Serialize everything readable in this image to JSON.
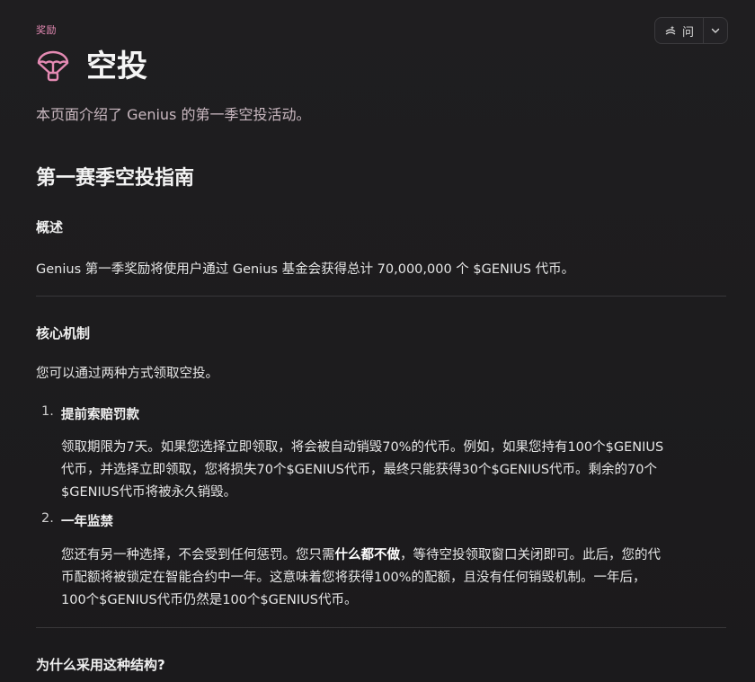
{
  "header": {
    "section_label": "奖励",
    "ask_button_label": "问",
    "title": "空投",
    "subtitle": "本页面介绍了 Genius 的第一季空投活动。"
  },
  "content": {
    "guide_heading": "第一赛季空投指南",
    "overview": {
      "heading": "概述",
      "text": "Genius 第一季奖励将使用户通过 Genius 基金会获得总计 70,000,000 个 $GENIUS 代币。"
    },
    "mechanism": {
      "heading": "核心机制",
      "intro": "您可以通过两种方式领取空投。",
      "items": [
        {
          "number": "1.",
          "title": "提前索赔罚款",
          "line1": "领取期限为7天。如果您选择立即领取，将会被自动销毁70%的代币。例如，如果您持有100个$GENIUS",
          "line2": "代币，并选择立即领取，您将损失70个$GENIUS代币，最终只能获得30个$GENIUS代币。剩余的70个",
          "line3": "$GENIUS代币将被永久销毁。"
        },
        {
          "number": "2.",
          "title": "一年监禁",
          "line1_pre": "您还有另一种选择，不会受到任何惩罚。您只需",
          "line1_bold": "什么都不做",
          "line1_post": "，等待空投领取窗口关闭即可。此后，您的代",
          "line2": "币配额将被锁定在智能合约中一年。这意味着您将获得100%的配额，且没有任何销毁机制。一年后，",
          "line3": "100个$GENIUS代币仍然是100个$GENIUS代币。"
        }
      ]
    },
    "why_heading": "为什么采用这种结构?"
  },
  "colors": {
    "accent": "#e48ab3",
    "background": "#1c1b1d",
    "text": "#ececec"
  },
  "icons": {
    "title_icon": "parachute-icon",
    "ask_icon": "sparkle-icon",
    "caret_icon": "chevron-down-icon"
  }
}
